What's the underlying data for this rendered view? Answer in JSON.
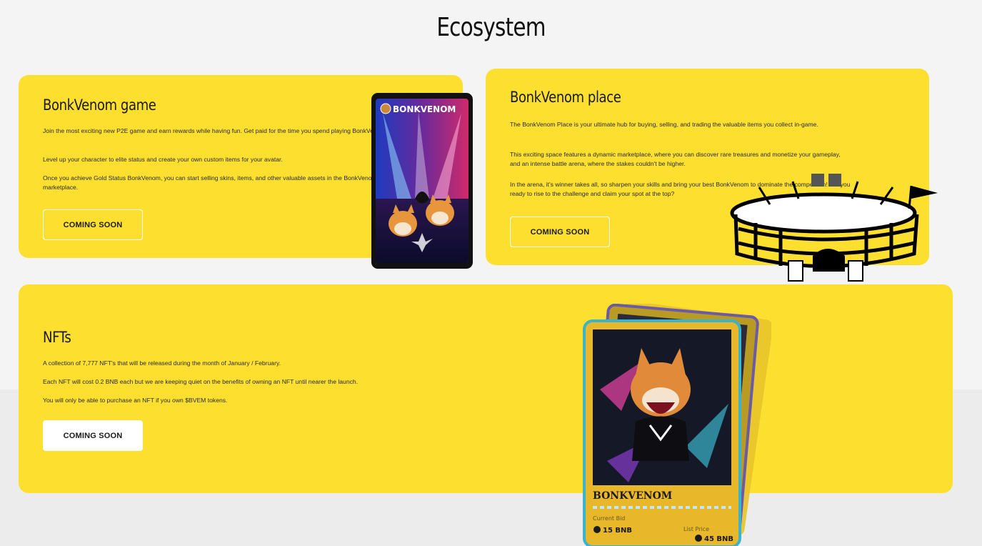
{
  "page": {
    "title": "Ecosystem"
  },
  "cards": {
    "game": {
      "title": "BonkVenom game",
      "paragraphs": [
        "Join the most exciting new P2E game and earn rewards while having fun. Get paid for the time you spend playing BonkVenom!",
        "Level up your character to elite status and create your own custom items for your avatar.",
        "Once you achieve Gold Status BonkVenom, you can start selling skins, items, and other valuable assets in the BonkVenom marketplace."
      ],
      "button_label": "COMING SOON"
    },
    "place": {
      "title": "BonkVenom place",
      "paragraphs": [
        "The BonkVenom Place is your ultimate hub for buying, selling, and trading the valuable items you collect in-game.",
        "This exciting space features a dynamic marketplace, where you can discover rare treasures and monetize your gameplay, and an intense battle arena, where the stakes couldn't be higher.",
        "In the arena, it's winner takes all, so sharpen your skills and bring your best BonkVenom to dominate the competition! Are you ready to rise to the challenge and claim your spot at the top?"
      ],
      "button_label": "COMING SOON"
    },
    "nft": {
      "title": "NFTs",
      "paragraphs": [
        "A collection of 7,777 NFT's that will be released during the month of January / February.",
        "Each NFT will cost 0.2 BNB each but we are keeping quiet on the benefits of owning an NFT until nearer the launch.",
        "You will only be able to purchase an NFT if you own $BVEM tokens."
      ],
      "button_label": "COMING SOON"
    }
  },
  "phone_screen": {
    "logo_text": "BONKVENOM"
  },
  "nft_card": {
    "name": "BONKVENOM",
    "current_bid_label": "Current Bid",
    "current_bid_value": "15 BNB",
    "list_price_label": "List Price",
    "list_price_value": "45 BNB"
  },
  "colors": {
    "card_yellow": "#fde02f",
    "page_bg": "#f4f4f4",
    "heading": "#111111"
  }
}
